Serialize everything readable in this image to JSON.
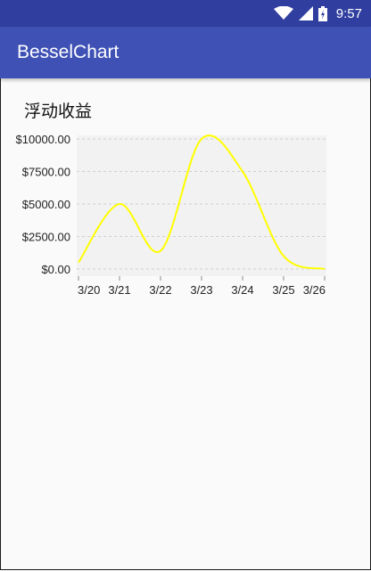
{
  "status_bar": {
    "time": "9:57"
  },
  "app_bar": {
    "title": "BesselChart"
  },
  "page": {
    "heading": "浮动收益"
  },
  "colors": {
    "status_bar": "#303f9f",
    "app_bar": "#3f51b5",
    "line": "#ffff00",
    "plot_bg": "#f2f2f2"
  },
  "chart_data": {
    "type": "line",
    "title": "",
    "xlabel": "",
    "ylabel": "",
    "categories": [
      "3/20",
      "3/21",
      "3/22",
      "3/23",
      "3/24",
      "3/25",
      "3/26"
    ],
    "y_ticks": [
      "$0.00",
      "$2500.00",
      "$5000.00",
      "$7500.00",
      "$10000.00"
    ],
    "y_tick_values": [
      0,
      2500,
      5000,
      7500,
      10000
    ],
    "ylim": [
      0,
      10000
    ],
    "grid": true,
    "series": [
      {
        "values": [
          500,
          5000,
          1400,
          10000,
          7500,
          1000,
          0
        ]
      }
    ]
  }
}
